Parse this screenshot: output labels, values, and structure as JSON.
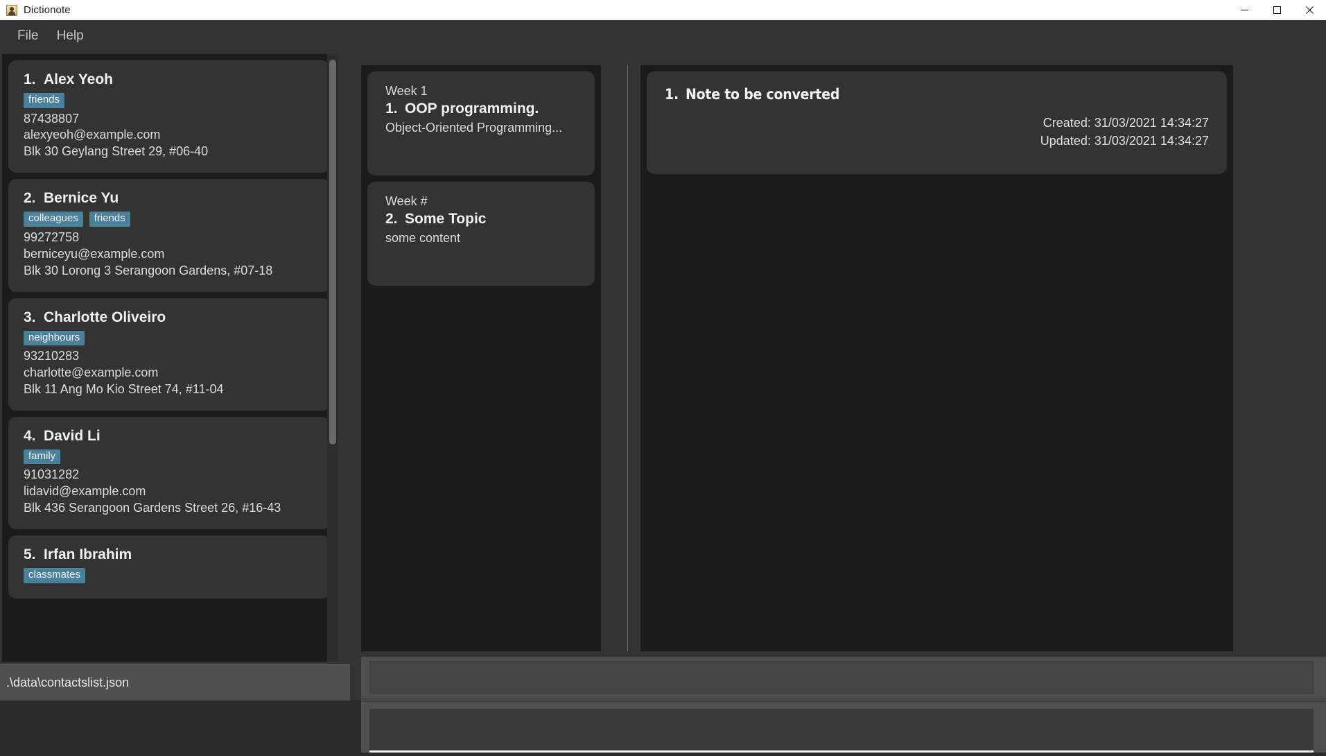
{
  "window": {
    "title": "Dictionote",
    "app_icon": "contact-card-icon",
    "buttons": {
      "minimize": "minimize-icon",
      "maximize": "maximize-icon",
      "close": "close-icon"
    }
  },
  "menubar": {
    "items": [
      {
        "label": "File"
      },
      {
        "label": "Help"
      }
    ]
  },
  "colors": {
    "accent_tag": "#4a8099",
    "panel_bg": "#1b1b1b",
    "card_bg": "#333333",
    "chrome_bg": "#4f4f4f",
    "text_primary": "#f0f0f0",
    "text_secondary": "#dcdcdc"
  },
  "contacts_panel": {
    "name": "contacts-list",
    "items": [
      {
        "index": "1.",
        "name": "Alex Yeoh",
        "tags": [
          "friends"
        ],
        "phone": "87438807",
        "email": "alexyeoh@example.com",
        "address": "Blk 30 Geylang Street 29, #06-40"
      },
      {
        "index": "2.",
        "name": "Bernice Yu",
        "tags": [
          "colleagues",
          "friends"
        ],
        "phone": "99272758",
        "email": "berniceyu@example.com",
        "address": "Blk 30 Lorong 3 Serangoon Gardens, #07-18"
      },
      {
        "index": "3.",
        "name": "Charlotte Oliveiro",
        "tags": [
          "neighbours"
        ],
        "phone": "93210283",
        "email": "charlotte@example.com",
        "address": "Blk 11 Ang Mo Kio Street 74, #11-04"
      },
      {
        "index": "4.",
        "name": "David Li",
        "tags": [
          "family"
        ],
        "phone": "91031282",
        "email": "lidavid@example.com",
        "address": "Blk 436 Serangoon Gardens Street 26, #16-43"
      },
      {
        "index": "5.",
        "name": "Irfan Ibrahim",
        "tags": [
          "classmates"
        ],
        "phone": "",
        "email": "",
        "address": ""
      }
    ]
  },
  "statusbar": {
    "path": ".\\data\\contactslist.json"
  },
  "notes_panel": {
    "name": "notes-list",
    "items": [
      {
        "week": "Week 1",
        "index": "1.",
        "title": "OOP programming.",
        "content": "Object-Oriented Programming..."
      },
      {
        "week": "Week #",
        "index": "2.",
        "title": "Some Topic",
        "content": "some content"
      }
    ]
  },
  "converted_note": {
    "index": "1.",
    "title": "Note to be converted",
    "created_label": "Created: 31/03/2021 14:34:27",
    "updated_label": "Updated: 31/03/2021 14:34:27"
  },
  "command_inputs": {
    "result_box": {
      "value": "",
      "placeholder": ""
    },
    "command_box": {
      "value": "",
      "placeholder": ""
    }
  }
}
